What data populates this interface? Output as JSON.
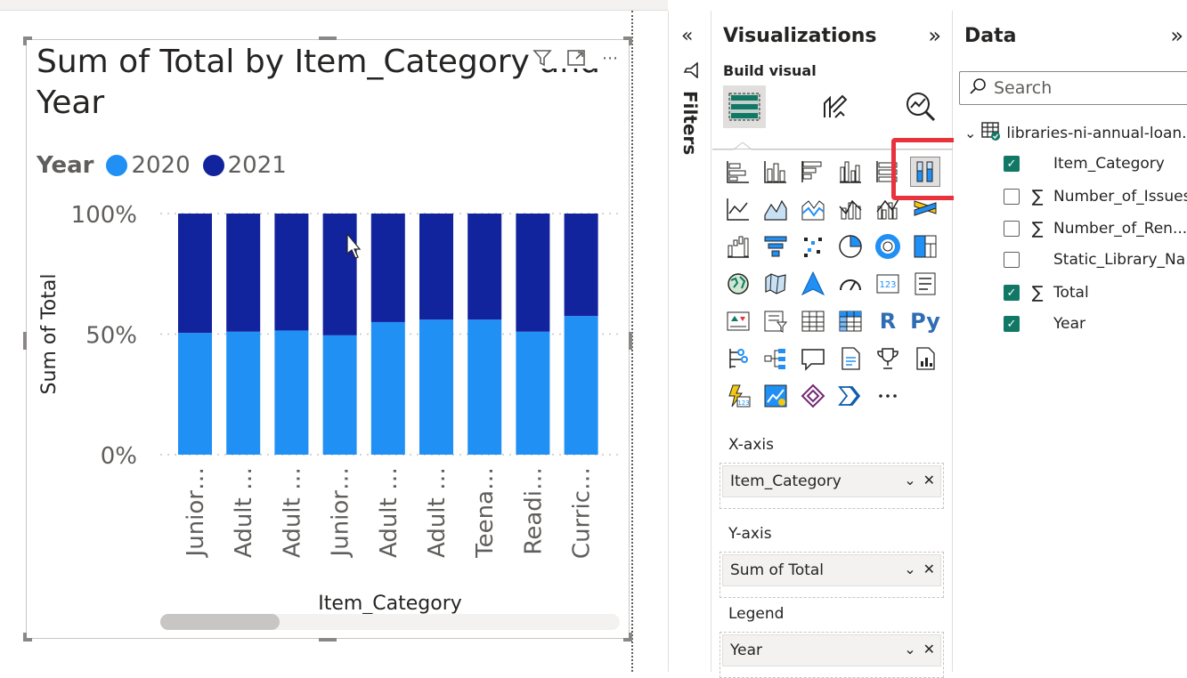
{
  "colors": {
    "series_2020": "#2190f5",
    "series_2021": "#12239e",
    "highlight": "#e8323c",
    "check": "#117865"
  },
  "visual": {
    "title": "Sum of Total by Item_Category and Year",
    "header_icons": [
      "filter-icon",
      "focus-mode-icon",
      "more-options-icon"
    ],
    "more_label": "⋯"
  },
  "chart_data": {
    "type": "bar",
    "stacked": "100%",
    "title": "Sum of Total by Item_Category and Year",
    "xlabel": "Item_Category",
    "ylabel": "Sum of Total",
    "legend_title": "Year",
    "legend_position": "top-left",
    "categories": [
      "Junior…",
      "Adult …",
      "Adult …",
      "Junior…",
      "Adult …",
      "Adult …",
      "Teena…",
      "Readi…",
      "Curric…"
    ],
    "series": [
      {
        "name": "2020",
        "values": [
          50.5,
          51,
          51.5,
          49.5,
          55,
          56,
          56,
          51,
          57.5
        ]
      },
      {
        "name": "2021",
        "values": [
          49.5,
          49,
          48.5,
          50.5,
          45,
          44,
          44,
          49,
          42.5
        ]
      }
    ],
    "yticks": [
      "0%",
      "50%",
      "100%"
    ],
    "ylim": [
      0,
      100
    ],
    "grid": true
  },
  "filters": {
    "label": "Filters",
    "collapse_glyph": "«"
  },
  "visualizations": {
    "title": "Visualizations",
    "expand_glyph": "»",
    "build_visual_label": "Build visual",
    "tabs": [
      "build-visual-tab",
      "format-visual-tab",
      "analytics-tab"
    ],
    "more_glyph": "⋯",
    "r_label": "R",
    "py_label": "Py",
    "wells": [
      {
        "label": "X-axis",
        "field": "Item_Category"
      },
      {
        "label": "Y-axis",
        "field": "Sum of Total"
      },
      {
        "label": "Legend",
        "field": "Year"
      }
    ]
  },
  "data_pane": {
    "title": "Data",
    "expand_glyph": "»",
    "search_placeholder": "Search",
    "table_name": "libraries-ni-annual-loan...",
    "fields": [
      {
        "name": "Item_Category",
        "checked": true,
        "sigma": false
      },
      {
        "name": "Number_of_Issues",
        "checked": false,
        "sigma": true
      },
      {
        "name": "Number_of_Ren...",
        "checked": false,
        "sigma": true
      },
      {
        "name": "Static_Library_Na...",
        "checked": false,
        "sigma": false
      },
      {
        "name": "Total",
        "checked": true,
        "sigma": true
      },
      {
        "name": "Year",
        "checked": true,
        "sigma": false
      }
    ]
  }
}
